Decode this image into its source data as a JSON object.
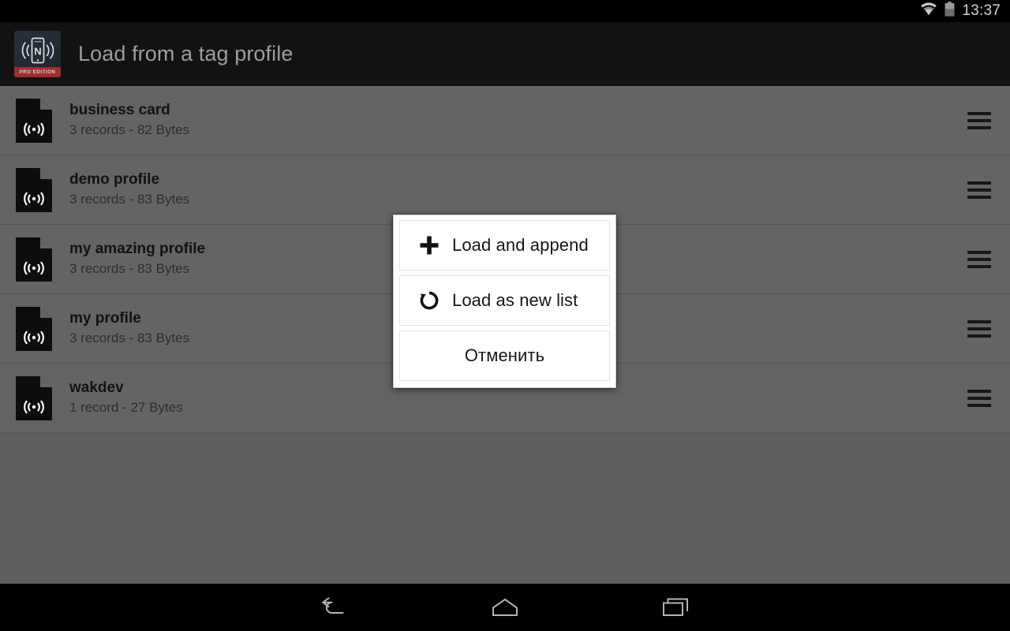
{
  "status_bar": {
    "time": "13:37",
    "wifi_icon": "wifi-icon",
    "battery_icon": "battery-icon",
    "battery_level_percent": 50
  },
  "action_bar": {
    "title": "Load from a tag profile",
    "app_icon": "nfc-tools-pro-app-icon",
    "app_icon_letter": "N",
    "app_icon_badge": "PRO EDITION"
  },
  "profile_list": {
    "row_icon": "nfc-tag-document-icon",
    "row_handle_icon": "drag-handle-icon",
    "items": [
      {
        "title": "business card",
        "subtitle": "3 records - 82 Bytes"
      },
      {
        "title": "demo profile",
        "subtitle": "3 records - 83 Bytes"
      },
      {
        "title": "my amazing profile",
        "subtitle": "3 records - 83 Bytes"
      },
      {
        "title": "my profile",
        "subtitle": "3 records - 83 Bytes"
      },
      {
        "title": "wakdev",
        "subtitle": "1 record - 27 Bytes"
      }
    ]
  },
  "dialog": {
    "buttons": [
      {
        "label": "Load and append",
        "icon": "plus-icon"
      },
      {
        "label": "Load as new list",
        "icon": "rotate-refresh-icon"
      },
      {
        "label": "Отменить",
        "icon": ""
      }
    ]
  },
  "nav_bar": {
    "back_icon": "back-arrow-icon",
    "home_icon": "home-icon",
    "recents_icon": "recents-icon"
  },
  "colors": {
    "status_bar_bg": "#000000",
    "action_bar_bg": "#121212",
    "action_bar_title": "#9d9d9d",
    "list_bg_dimmed": "#646464",
    "list_divider": "#575757",
    "dialog_bg": "#ffffff",
    "dialog_text": "#161616",
    "pro_badge": "#9c2f32"
  }
}
